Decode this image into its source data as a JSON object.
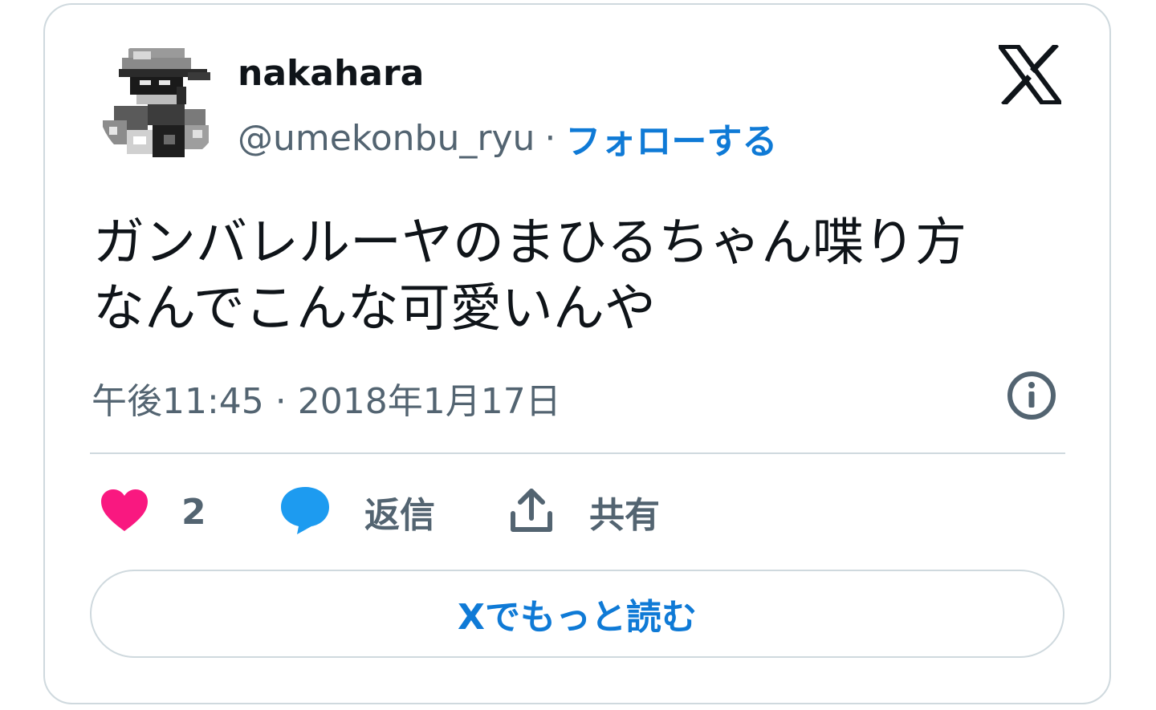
{
  "author": {
    "display_name": "nakahara",
    "handle": "@umekonbu_ryu",
    "separator": "·",
    "follow_label": "フォローする"
  },
  "tweet": {
    "text_line1": "ガンバレルーヤのまひるちゃん喋り方",
    "text_line2": "なんでこんな可愛いんや",
    "timestamp": "午後11:45 · 2018年1月17日"
  },
  "actions": {
    "like_count": "2",
    "reply_label": "返信",
    "share_label": "共有"
  },
  "read_more_label": "Xでもっと読む",
  "colors": {
    "link": "#0f7ad6",
    "heart": "#f91880",
    "reply_bubble": "#1d9bf0",
    "muted_text": "#536471",
    "border": "#cfd9de"
  },
  "icons": {
    "brand": "x-logo-icon",
    "info": "info-icon",
    "like": "heart-icon",
    "reply": "reply-bubble-icon",
    "share": "share-upload-icon"
  }
}
